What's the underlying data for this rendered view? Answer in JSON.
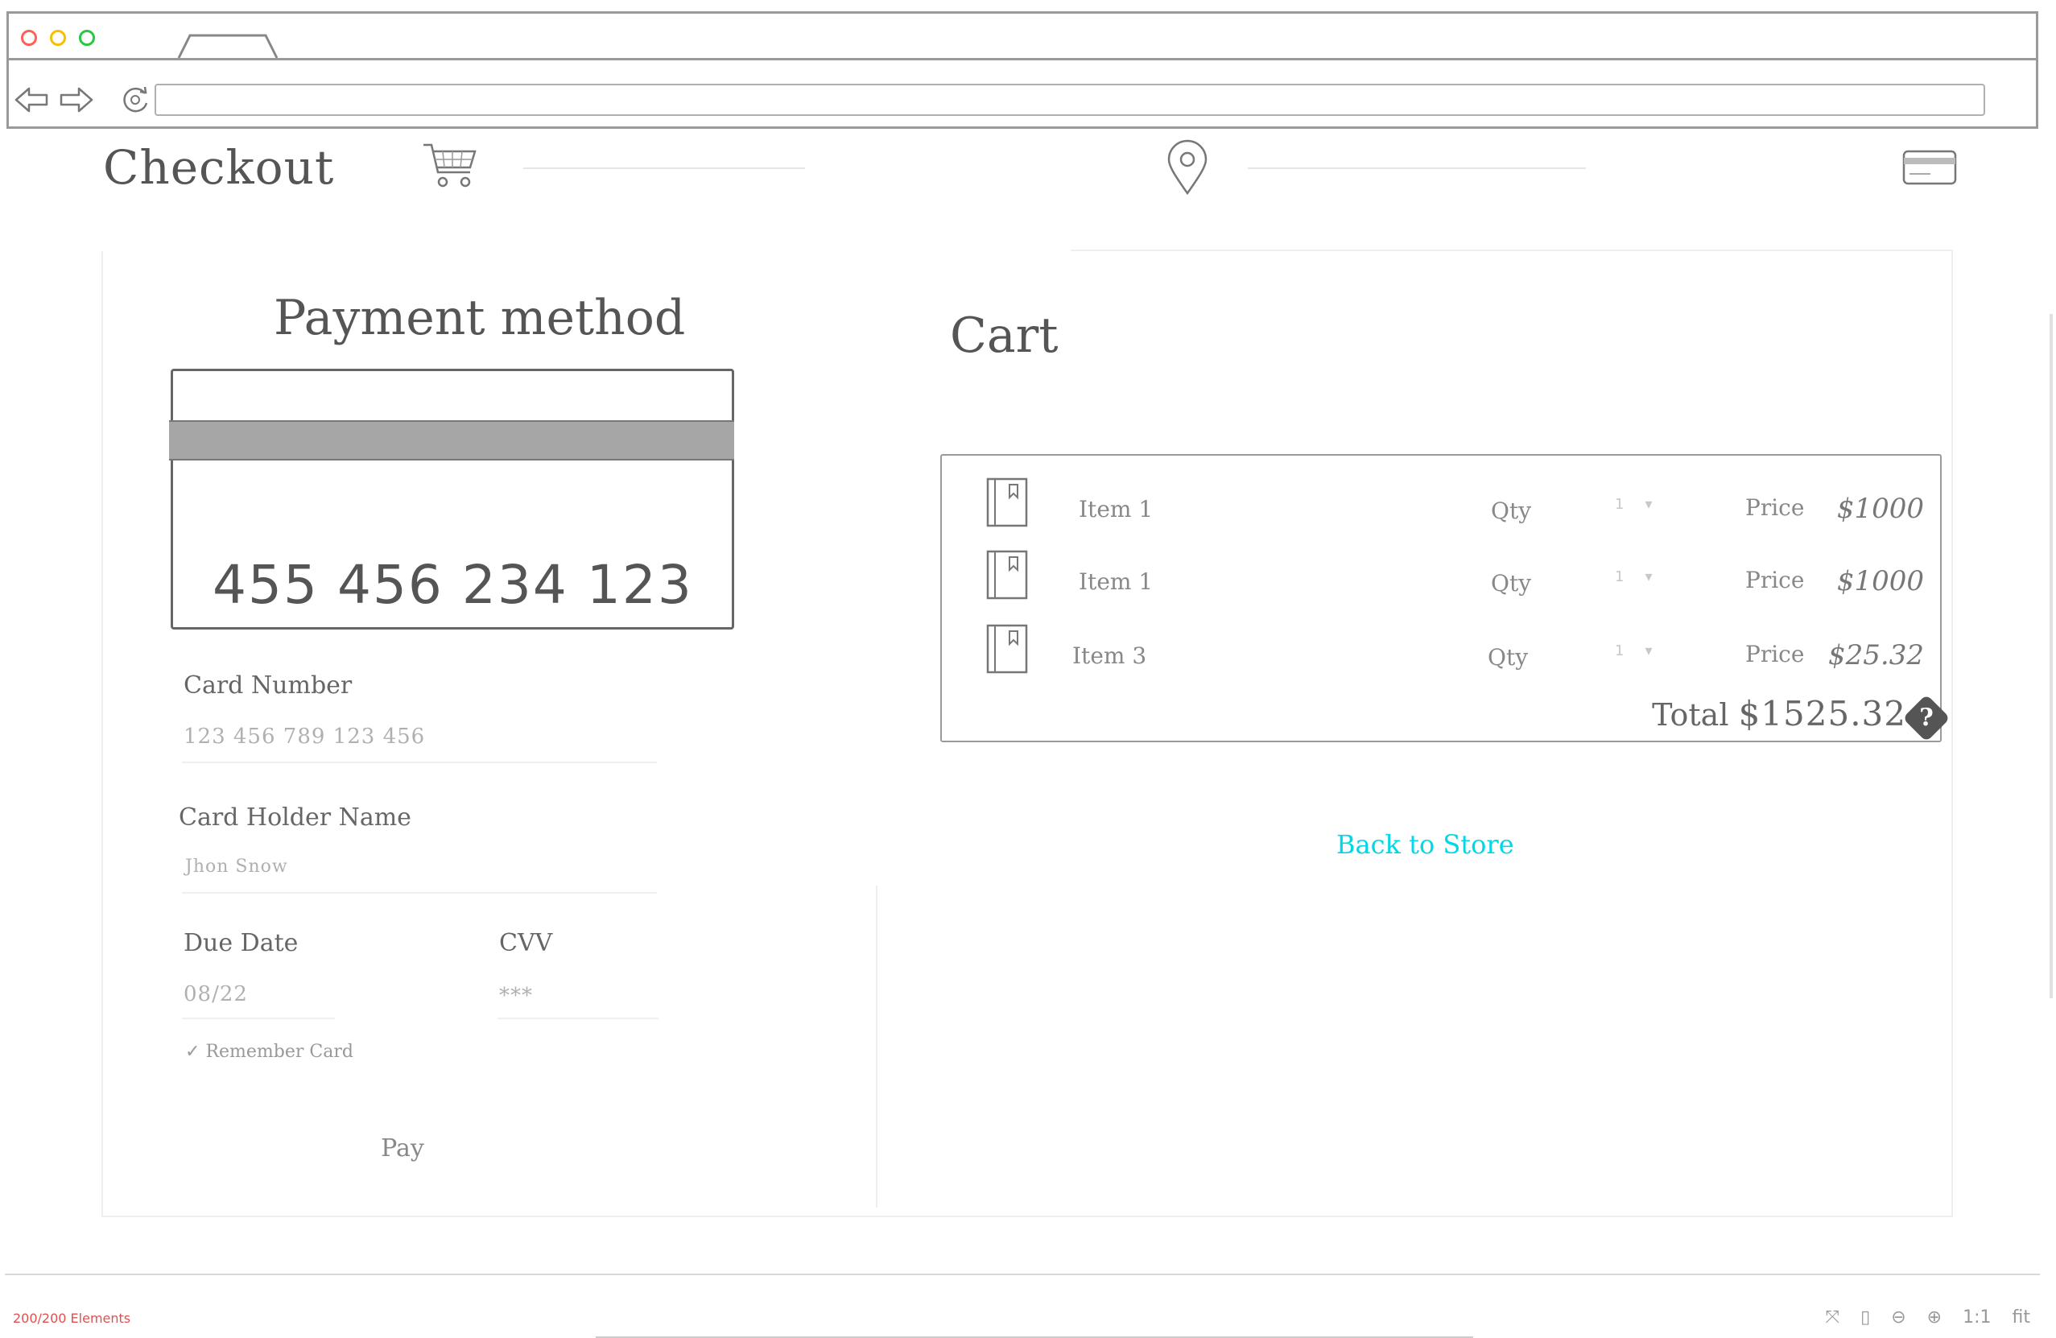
{
  "browser": {
    "url": "",
    "back_icon": "arrow-left-icon",
    "forward_icon": "arrow-right-icon",
    "reload_icon": "reload-icon"
  },
  "header": {
    "title": "Checkout",
    "steps": [
      {
        "name": "cart",
        "icon": "shopping-cart-icon"
      },
      {
        "name": "shipping",
        "icon": "location-pin-icon"
      },
      {
        "name": "payment",
        "icon": "credit-card-icon"
      }
    ]
  },
  "payment": {
    "title": "Payment method",
    "card_display_number": "455 456 234 123",
    "fields": {
      "card_number": {
        "label": "Card Number",
        "placeholder": "123 456 789 123 456"
      },
      "holder_name": {
        "label": "Card Holder Name",
        "placeholder": "Jhon Snow"
      },
      "due_date": {
        "label": "Due Date",
        "placeholder": "08/22"
      },
      "cvv": {
        "label": "CVV",
        "placeholder": "***"
      }
    },
    "remember": {
      "label": "Remember Card",
      "checked": true
    },
    "pay_label": "Pay"
  },
  "cart": {
    "title": "Cart",
    "qty_label": "Qty",
    "price_label": "Price",
    "items": [
      {
        "name": "Item 1",
        "qty": "1",
        "price": "$1000"
      },
      {
        "name": "Item 1",
        "qty": "1",
        "price": "$1000"
      },
      {
        "name": "Item 3",
        "qty": "1",
        "price": "$25.32"
      }
    ],
    "total_label": "Total",
    "total_value": "$1525.32",
    "help_glyph": "?",
    "back_link": "Back to Store",
    "link_color": "#00d8e8"
  },
  "status": {
    "elements_count": "200/200 Elements",
    "zoom_actual": "1:1",
    "zoom_fit": "fit"
  }
}
